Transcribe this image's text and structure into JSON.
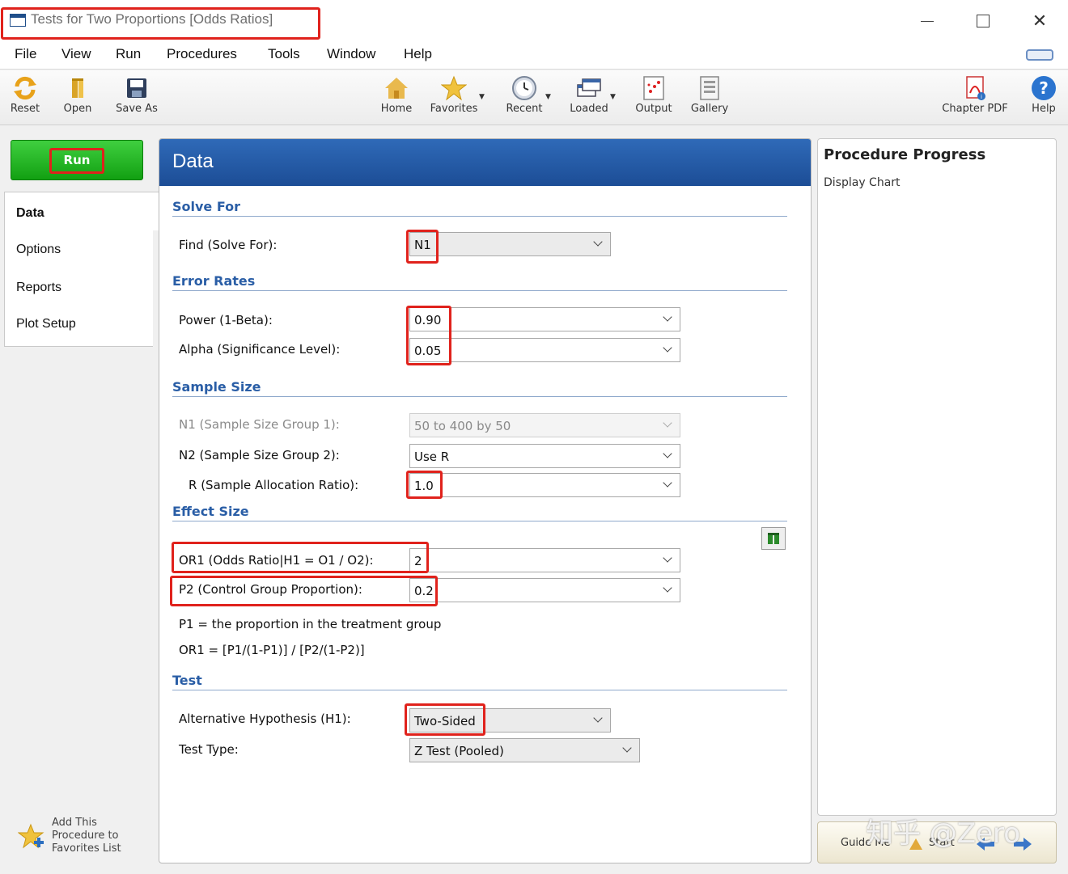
{
  "window": {
    "title": "Tests for Two Proportions [Odds Ratios]"
  },
  "menu": [
    "File",
    "View",
    "Run",
    "Procedures",
    "Tools",
    "Window",
    "Help"
  ],
  "toolbar": {
    "reset": "Reset",
    "open": "Open",
    "save_as": "Save As",
    "home": "Home",
    "favorites": "Favorites",
    "recent": "Recent",
    "loaded": "Loaded",
    "output": "Output",
    "gallery": "Gallery",
    "chapter_pdf": "Chapter PDF",
    "help": "Help"
  },
  "left": {
    "run": "Run",
    "nav": [
      "Data",
      "Options",
      "Reports",
      "Plot Setup"
    ],
    "favorites_text": [
      "Add This",
      "Procedure to",
      "Favorites List"
    ]
  },
  "main": {
    "header": "Data",
    "sections": {
      "solve_for": "Solve For",
      "error_rates": "Error Rates",
      "sample_size": "Sample Size",
      "effect_size": "Effect Size",
      "test": "Test"
    },
    "fields": {
      "find": {
        "label": "Find (Solve For):",
        "value": "N1"
      },
      "power": {
        "label": "Power (1-Beta):",
        "value": "0.90"
      },
      "alpha": {
        "label": "Alpha (Significance Level):",
        "value": "0.05"
      },
      "n1": {
        "label": "N1 (Sample Size Group 1):",
        "value": "50 to 400 by 50"
      },
      "n2": {
        "label": "N2 (Sample Size Group 2):",
        "value": "Use R"
      },
      "r": {
        "label": "R (Sample Allocation Ratio):",
        "value": "1.0"
      },
      "or1": {
        "label": "OR1 (Odds Ratio|H1 =  O1 / O2):",
        "value": "2"
      },
      "p2": {
        "label": "P2 (Control Group Proportion):",
        "value": "0.2"
      },
      "alt": {
        "label": "Alternative Hypothesis (H1):",
        "value": "Two-Sided"
      },
      "test_type": {
        "label": "Test Type:",
        "value": "Z Test (Pooled)"
      }
    },
    "notes": [
      "P1 = the proportion in the treatment group",
      "OR1 = [P1/(1-P1)] / [P2/(1-P2)]"
    ]
  },
  "progress": {
    "title": "Procedure Progress",
    "subtitle": "Display Chart"
  },
  "guide": {
    "guide_me": "Guide Me",
    "start": "Start"
  },
  "watermark": "知乎 @Zero",
  "colors": {
    "accent_blue": "#1c4d96",
    "run_green": "#12a012",
    "highlight_red": "#e0221c"
  }
}
